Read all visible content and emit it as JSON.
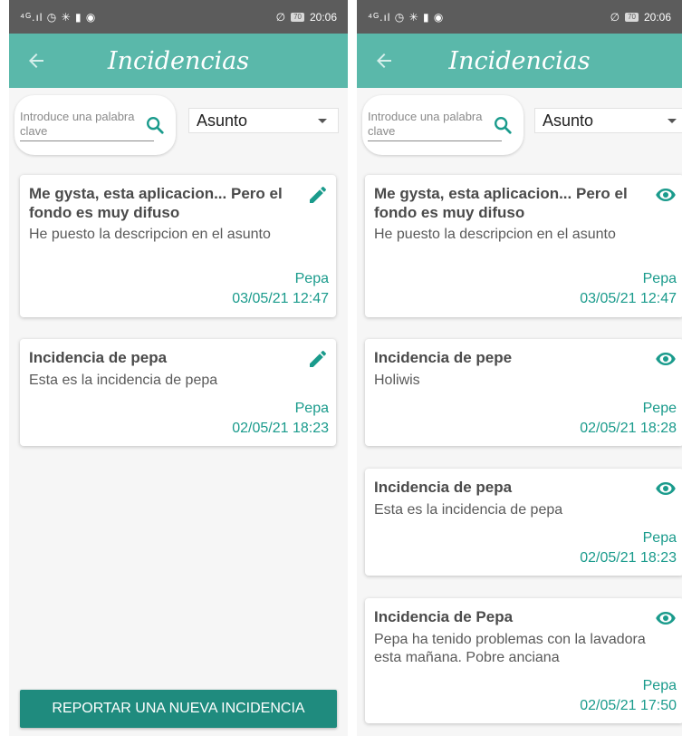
{
  "status_bar": {
    "left_icons": "⁴ᴳ.ıl ◷ ✳ ▮ ◉",
    "battery": "70",
    "time": "20:06"
  },
  "app_bar": {
    "title": "Incidencias"
  },
  "search": {
    "placeholder": "Introduce una palabra clave"
  },
  "filter": {
    "selected": "Asunto"
  },
  "left_screen": {
    "incidents": [
      {
        "title": "Me gysta, esta aplicacion... Pero el fondo es muy difuso",
        "description": "He puesto la descripcion en el asunto",
        "user": "Pepa",
        "date": "03/05/21 12:47",
        "action_icon": "edit-icon"
      },
      {
        "title": "Incidencia de pepa",
        "description": "Esta es la incidencia de pepa",
        "user": "Pepa",
        "date": "02/05/21 18:23",
        "action_icon": "edit-icon"
      }
    ],
    "report_button": "REPORTAR UNA NUEVA INCIDENCIA"
  },
  "right_screen": {
    "incidents": [
      {
        "title": "Me gysta, esta aplicacion... Pero el fondo es muy difuso",
        "description": "He puesto la descripcion en el asunto",
        "user": "Pepa",
        "date": "03/05/21 12:47",
        "action_icon": "eye-icon"
      },
      {
        "title": "Incidencia de pepe",
        "description": "Holiwis",
        "user": "Pepe",
        "date": "02/05/21 18:28",
        "action_icon": "eye-icon"
      },
      {
        "title": "Incidencia de pepa",
        "description": "Esta es la incidencia de pepa",
        "user": "Pepa",
        "date": "02/05/21 18:23",
        "action_icon": "eye-icon"
      },
      {
        "title": "Incidencia de Pepa",
        "description": "Pepa ha tenido problemas con la lavadora esta mañana. Pobre anciana",
        "user": "Pepa",
        "date": "02/05/21 17:50",
        "action_icon": "eye-icon"
      }
    ]
  },
  "colors": {
    "app_bar": "#5ab8aa",
    "accent_text": "#1a9b8c",
    "button": "#1f8b7e",
    "status_bar": "#5c5c5c"
  }
}
